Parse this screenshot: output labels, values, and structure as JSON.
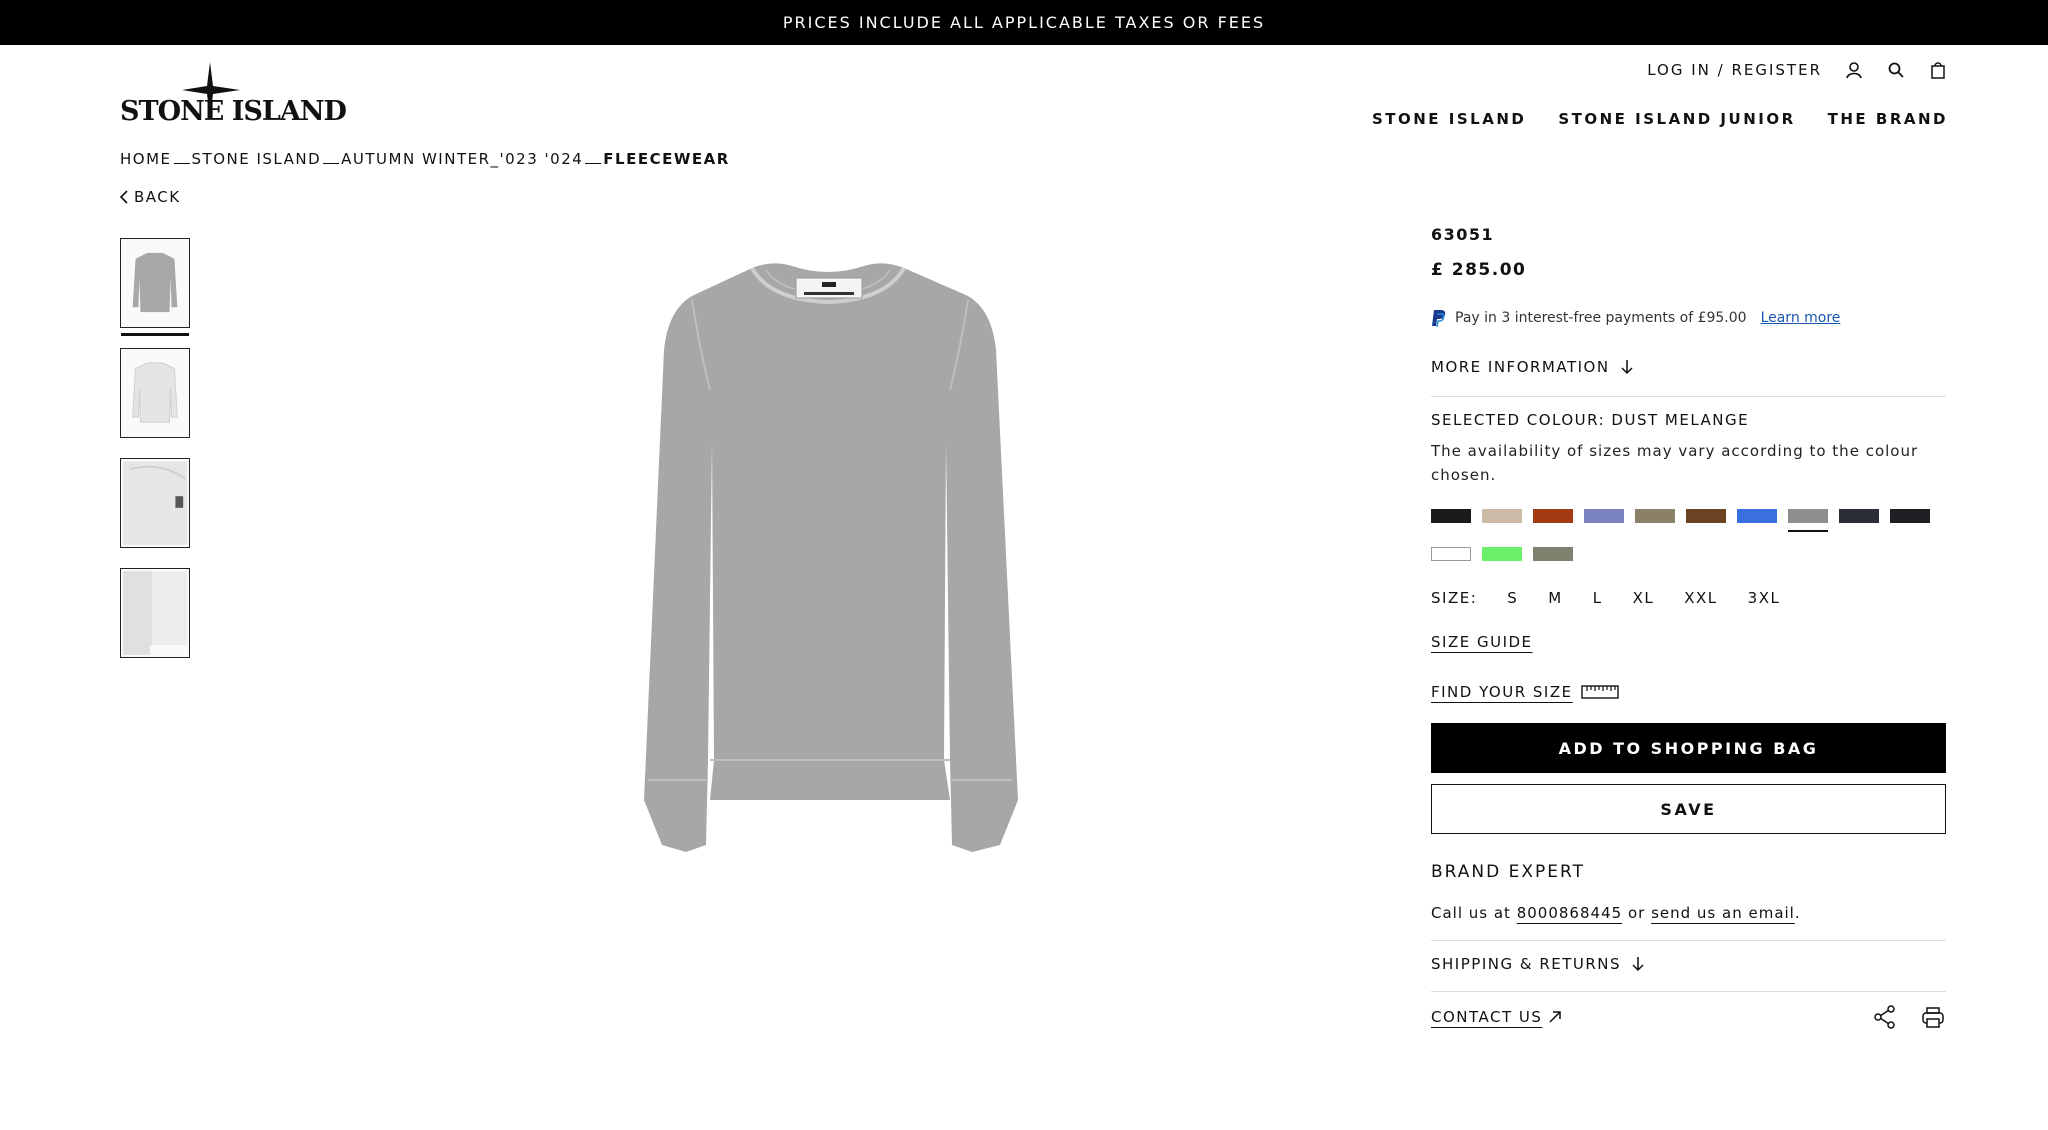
{
  "announcement": "PRICES INCLUDE ALL APPLICABLE TAXES OR FEES",
  "logo": {
    "text": "STONE ISLAND"
  },
  "account": {
    "login_label": "LOG IN / REGISTER"
  },
  "nav": {
    "items": [
      "STONE ISLAND",
      "STONE ISLAND JUNIOR",
      "THE BRAND"
    ]
  },
  "breadcrumb": {
    "items": [
      "HOME",
      "STONE ISLAND",
      "AUTUMN WINTER_'023 '024"
    ],
    "current": "FLEECEWEAR"
  },
  "back_label": "BACK",
  "product": {
    "code": "63051",
    "price": "£ 285.00",
    "paypal_text": "Pay in 3 interest-free payments of £95.00",
    "paypal_link": "Learn more",
    "more_info": "MORE INFORMATION",
    "selected_colour": "SELECTED COLOUR: DUST MELANGE",
    "colour_note": "The availability of sizes may vary according to the colour chosen.",
    "swatches": [
      "#1b1b1b",
      "#cdbba8",
      "#a33a14",
      "#7a82bf",
      "#8a8167",
      "#6b4523",
      "#3a6fe0",
      "#8e8e8e",
      "#2a2d36",
      "#1e1f22",
      "#ffffff",
      "#6cf06a",
      "#7c826e"
    ],
    "selected_swatch_index": 7,
    "size_label": "SIZE:",
    "sizes": [
      "S",
      "M",
      "L",
      "XL",
      "XXL",
      "3XL"
    ],
    "size_guide": "SIZE GUIDE",
    "find_size": "FIND YOUR SIZE",
    "add_to_bag": "ADD TO SHOPPING BAG",
    "save": "SAVE"
  },
  "expert": {
    "title": "BRAND EXPERT",
    "call_prefix": "Call us at",
    "phone": "8000868445",
    "or": "or",
    "email_link": "send us an email",
    "period": "."
  },
  "shipping_label": "SHIPPING & RETURNS",
  "contact_label": "CONTACT US"
}
